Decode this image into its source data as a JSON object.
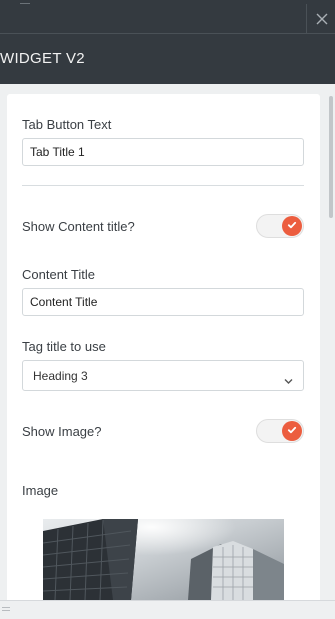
{
  "panel": {
    "title": "WIDGET V2"
  },
  "icons": {
    "close": "close-icon",
    "check": "check-icon",
    "chevron": "chevron-down-icon",
    "resize": "resize-handle-icon"
  },
  "colors": {
    "header_bg": "#343a40",
    "accent": "#ec5d3f",
    "content_bg": "#eef0f1",
    "card_bg": "#ffffff"
  },
  "form": {
    "tab_button_text": {
      "label": "Tab Button Text",
      "value": "Tab Title 1"
    },
    "show_content_title": {
      "label": "Show Content title?",
      "on": true
    },
    "content_title": {
      "label": "Content Title",
      "value": "Content Title"
    },
    "tag_title": {
      "label": "Tag title to use",
      "selected": "Heading 3"
    },
    "show_image": {
      "label": "Show Image?",
      "on": true
    },
    "image": {
      "label": "Image"
    }
  }
}
